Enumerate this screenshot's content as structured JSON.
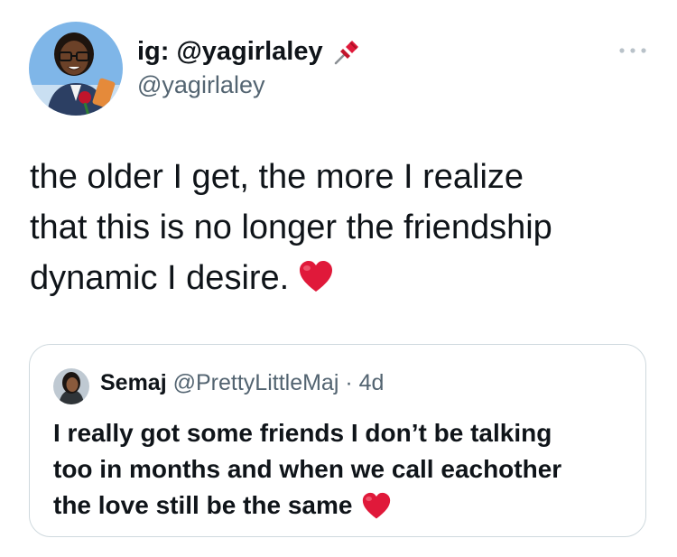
{
  "author": {
    "display_name": "ig: @yagirlaley",
    "handle": "@yagirlaley",
    "pin_emoji": "pushpin-icon"
  },
  "tweet": {
    "text": "the older I get, the more I realize\nthat this is no longer the friendship\ndynamic I desire.",
    "trailing_emoji": "red-heart-emoji"
  },
  "quoted_tweet": {
    "name": "Semaj",
    "handle": "@PrettyLittleMaj",
    "separator": "·",
    "time": "4d",
    "text": "I really got some friends I don’t be talking\ntoo in months and when we call eachother\nthe love still be the same",
    "trailing_emoji": "red-heart-emoji"
  },
  "colors": {
    "text": "#0f1419",
    "secondary_text": "#536471",
    "border": "#cfd9de",
    "heart": "#e0193a"
  }
}
